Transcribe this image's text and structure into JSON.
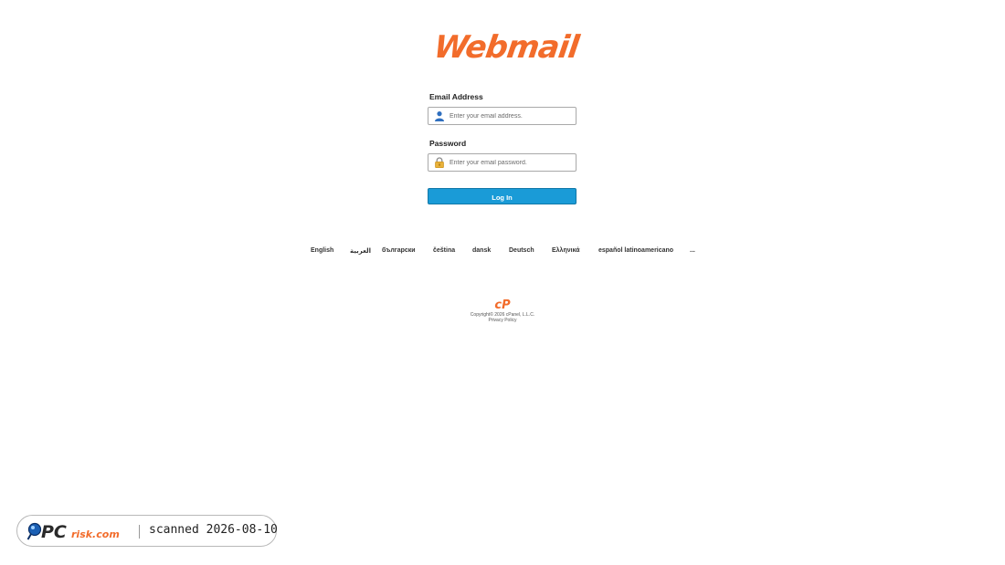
{
  "logo": {
    "text": "Webmail",
    "color": "#f26c2b"
  },
  "form": {
    "email_label": "Email Address",
    "email_placeholder": "Enter your email address.",
    "password_label": "Password",
    "password_placeholder": "Enter your email password.",
    "login_label": "Log In"
  },
  "icons": {
    "email": "user-icon",
    "password": "lock-icon"
  },
  "colors": {
    "accent": "#1a9bd7",
    "brand": "#f26c2b"
  },
  "languages": [
    "English",
    "العربية",
    "български",
    "čeština",
    "dansk",
    "Deutsch",
    "Ελληνικά",
    "español latinoamericano",
    "..."
  ],
  "footer": {
    "logo": "cP",
    "copyright": "Copyright© 2026 cPanel, L.L.C.",
    "privacy": "Privacy Policy"
  },
  "badge": {
    "brand_pc": "PC",
    "brand_rest": "risk.com",
    "text": "scanned 2026-08-10"
  }
}
